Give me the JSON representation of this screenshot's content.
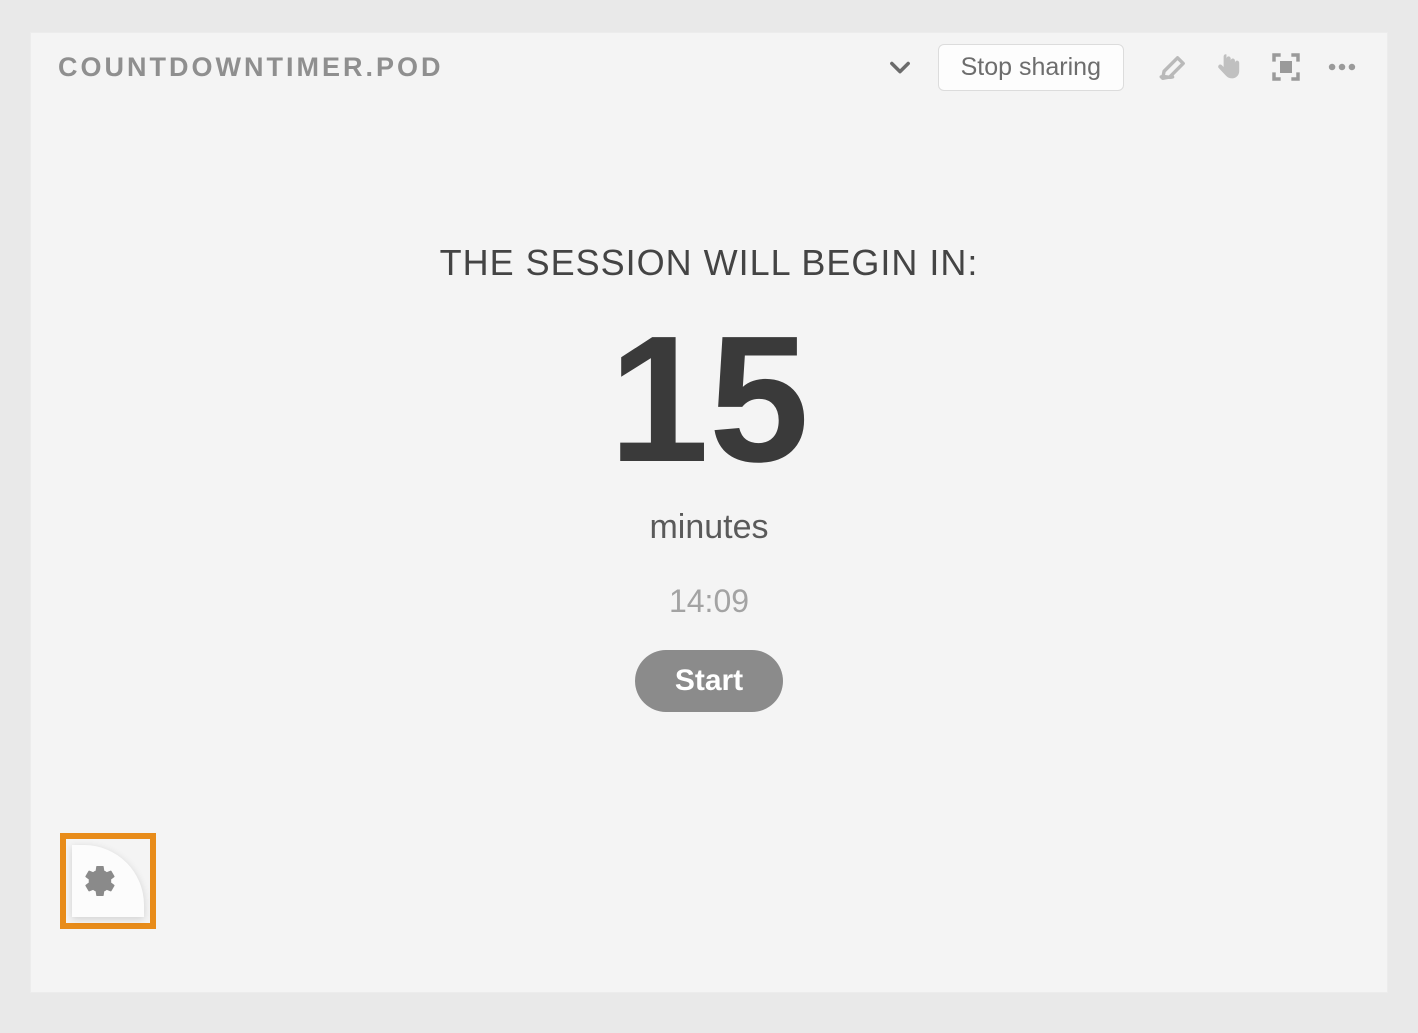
{
  "header": {
    "title": "COUNTDOWNTIMER.POD",
    "stop_sharing_label": "Stop sharing"
  },
  "timer": {
    "heading": "THE SESSION WILL BEGIN IN:",
    "value": "15",
    "units_label": "minutes",
    "clock": "14:09",
    "start_label": "Start"
  },
  "colors": {
    "highlight_border": "#e88c1a",
    "text_dark": "#3a3a3a",
    "text_muted": "#8f8f8f",
    "button_bg": "#8b8b8b"
  }
}
